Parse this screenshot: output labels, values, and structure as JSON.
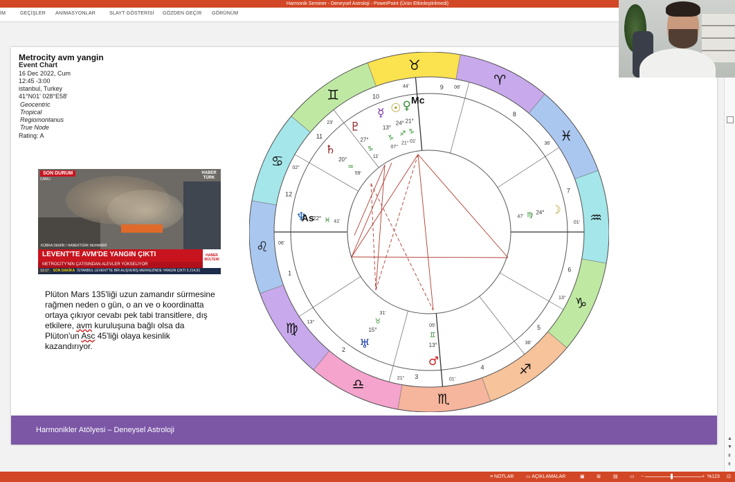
{
  "window": {
    "title": "Harmonik Seminer - Deneysel Astroloji -  PowerPoint (Ürün Etkinleştirilmedi)"
  },
  "ribbon": {
    "tabs": [
      "İM",
      "GEÇİŞLER",
      "ANİMASYONLAR",
      "SLAYT GÖSTERİSİ",
      "GÖZDEN GEÇİR",
      "GÖRÜNÜM"
    ]
  },
  "chart_info": {
    "title": "Metrocity avm yangin",
    "lines": [
      "Event Chart",
      "16 Dec 2022, Cum",
      "12:45 -3:00",
      "istanbul, Turkey",
      "41°N01' 028°E58'"
    ],
    "italic_lines": [
      "Geocentric",
      "Tropical",
      "Regiomontanus",
      "True Node"
    ],
    "rating": "Rating: A"
  },
  "news": {
    "badge": "SON DURUM",
    "live": "CANLI",
    "channel": "HABER TÜRK",
    "reporter": "KÜBRA DEMİR / HABERTÜRK MUHABİRİ",
    "headline": "LEVENT'TE AVM'DE YANGIN ÇIKTI",
    "subheadline": "METROCITY'NİN ÇATISINDAN ALEVLER YÜKSELİYOR",
    "bulletin": "HABER BÜLTENİ",
    "time": "13:17",
    "ticker_label": "SON DAKİKA",
    "ticker": "İSTANBUL LEVENT'TE BİR ALIŞVERİŞ MERKEZİNDE YANGIN ÇIKTI",
    "ticker_value": "5.214,91"
  },
  "description": {
    "part1": "Plüton Mars 135'liği uzun zamandır sürmesine rağmen neden o gün, o an ve o koordinatta ortaya çıkıyor cevabı pek tabi transitlere, dış etkilere, ",
    "avm": "avm",
    "part2": " kuruluşuna bağlı olsa da Plüton'un ",
    "asc": "Asc",
    "part3": " 45'liği olaya kesinlik kazandırıyor."
  },
  "footer": {
    "text": "Harmonikler Atölyesi – Deneysel Astroloji"
  },
  "wheel": {
    "sign_colors": [
      "#fbe24f",
      "#bfe9a2",
      "#a4e6ea",
      "#aac7f0",
      "#c8a9ec",
      "#f4a4cd",
      "#f6b59d",
      "#f7c39a",
      "#bfe9a2",
      "#a4e6ea",
      "#aac7f0",
      "#c8a9ec"
    ],
    "sign_glyphs": [
      "♉",
      "♊",
      "♋",
      "♌",
      "♍",
      "♎",
      "♏",
      "♐",
      "♑",
      "♒",
      "♓",
      "♈"
    ],
    "house_numbers": [
      "1",
      "2",
      "3",
      "4",
      "5",
      "6",
      "7",
      "8",
      "9",
      "10",
      "11",
      "12"
    ],
    "house_degrees": [
      "06'",
      "13°",
      "21°",
      "01'",
      "36'",
      "13°",
      "01'",
      "36'",
      "06'",
      "44'",
      "23'",
      "02°"
    ],
    "planets": [
      {
        "glyph": "☽",
        "name": "Moon",
        "deg": "24°",
        "sign": "♍",
        "min": "47'",
        "color": "#b8a030"
      },
      {
        "glyph": "♂",
        "name": "Mars",
        "deg": "13°",
        "sign": "♊",
        "min": "05'",
        "color": "#cc2222"
      },
      {
        "glyph": "☉",
        "name": "Sun",
        "deg": "24°",
        "sign": "♐",
        "min": "21°",
        "color": "#a08a00"
      },
      {
        "glyph": "♀",
        "name": "Venus",
        "deg": "21°",
        "sign": "♑",
        "min": "01'",
        "color": "#338833"
      },
      {
        "glyph": "☿",
        "name": "Mercury",
        "deg": "13°",
        "sign": "♑",
        "min": "07°",
        "color": "#7a2aa8"
      },
      {
        "glyph": "♄",
        "name": "Saturn",
        "deg": "20°",
        "sign": "♒",
        "min": "59'",
        "color": "#8b1a1a"
      },
      {
        "glyph": "♆",
        "name": "Neptune",
        "deg": "22°",
        "sign": "♓",
        "min": "41'",
        "color": "#1a5aa8"
      },
      {
        "glyph": "♅",
        "name": "Uranus",
        "deg": "15°",
        "sign": "♉",
        "min": "31'",
        "color": "#1a3aa8"
      },
      {
        "glyph": "♇",
        "name": "Pluto",
        "deg": "27°",
        "sign": "♑",
        "min": "11'",
        "color": "#8b1a1a"
      }
    ],
    "labels": [
      "As",
      "Mc"
    ]
  },
  "status": {
    "notes": "NOTLAR",
    "comments": "AÇIKLAMALAR",
    "zoom": "%123"
  }
}
